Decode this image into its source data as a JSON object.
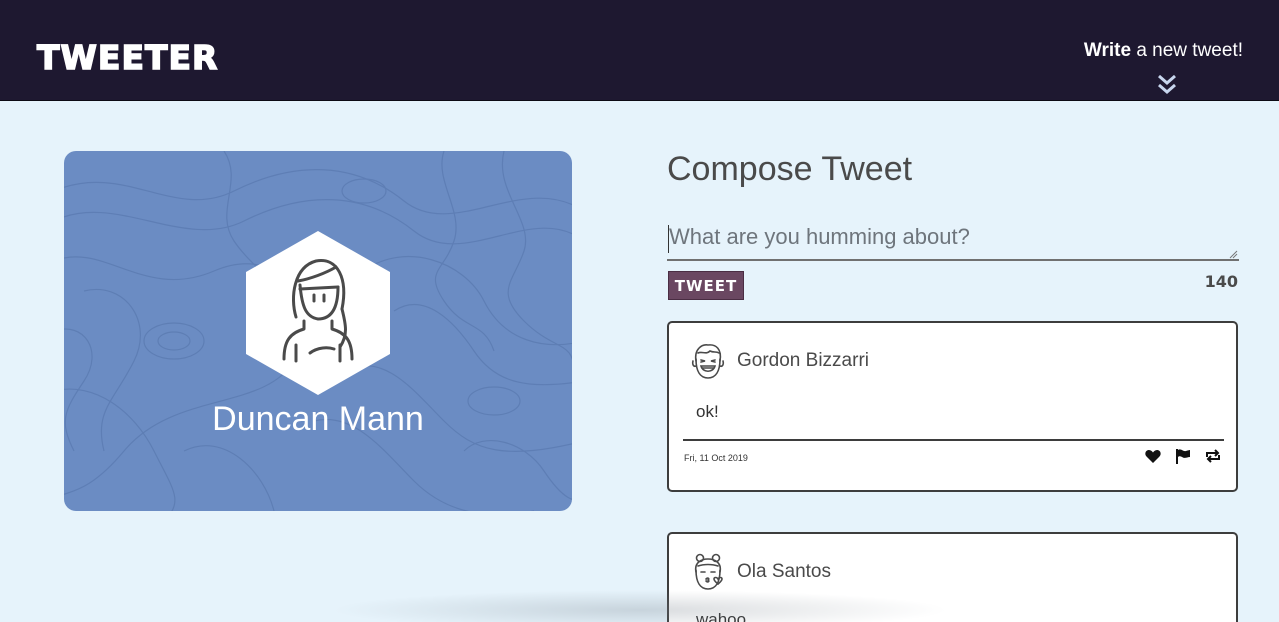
{
  "nav": {
    "brand": "TWEETER",
    "write_bold": "Write",
    "write_rest": " a new tweet!",
    "chevron_icon": "double-chevron-down-icon"
  },
  "profile": {
    "name": "Duncan Mann",
    "avatar_icon": "girl-avatar-icon",
    "background_color": "#6b8cc3"
  },
  "compose": {
    "title": "Compose Tweet",
    "placeholder": "What are you humming about?",
    "button_label": "TWEET",
    "counter": "140"
  },
  "tweets": [
    {
      "name": "Gordon Bizzarri",
      "avatar_icon": "laughing-man-avatar-icon",
      "text": "ok!",
      "date": "Fri, 11 Oct 2019",
      "actions": [
        "heart-icon",
        "flag-icon",
        "retweet-icon"
      ]
    },
    {
      "name": "Ola Santos",
      "avatar_icon": "kissing-girl-avatar-icon",
      "text": "wahoo"
    }
  ],
  "colors": {
    "nav_bg": "#1e1830",
    "page_bg": "#e6f3fb",
    "button_bg": "#6a4761"
  }
}
